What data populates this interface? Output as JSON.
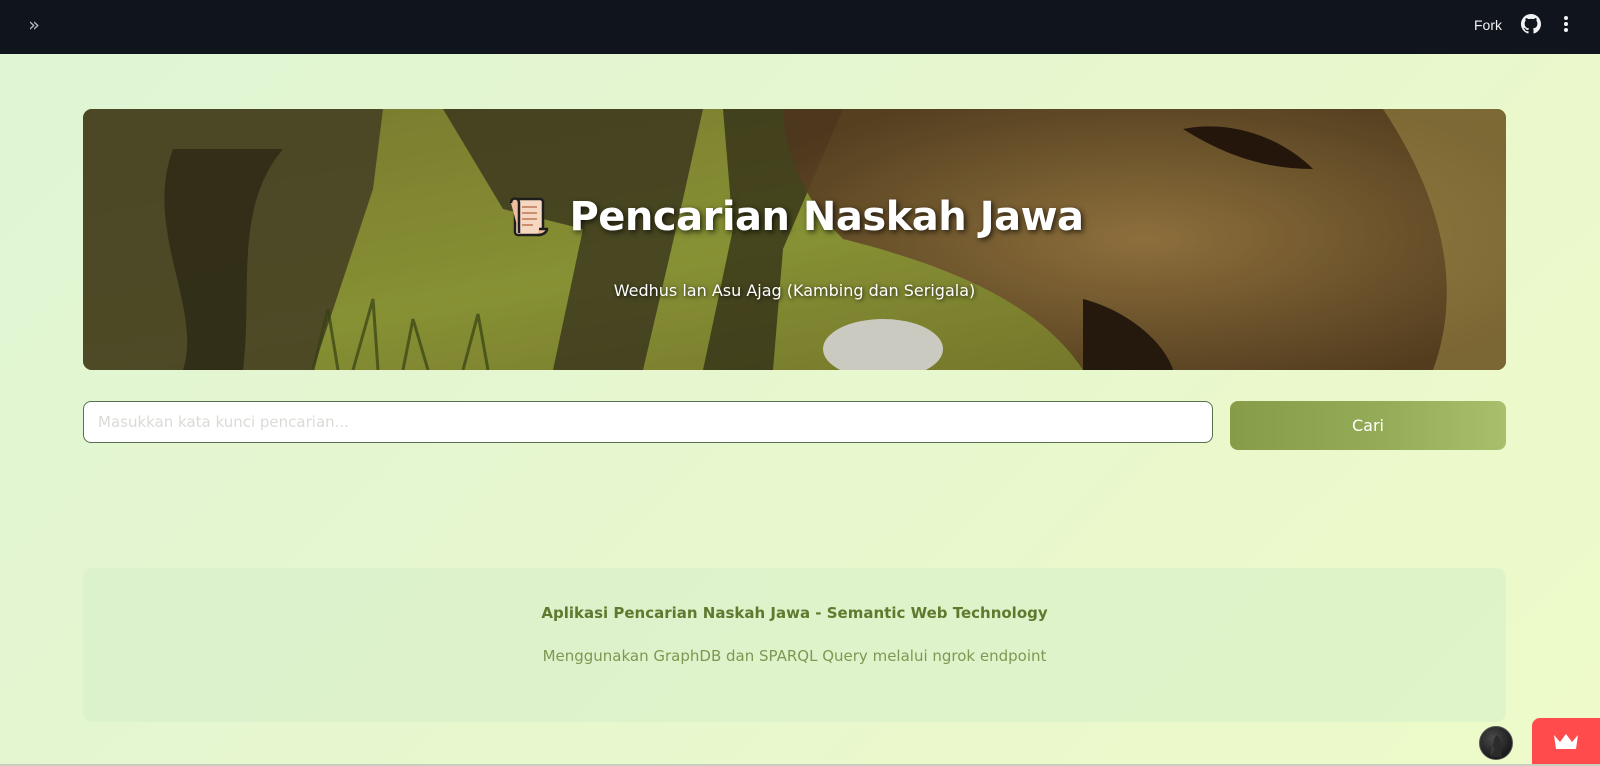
{
  "topbar": {
    "sidebar_toggle_icon": "double-chevron-right-icon",
    "fork_label": "Fork",
    "github_icon": "github-icon",
    "menu_icon": "kebab-menu-icon",
    "background_color": "#0f141d"
  },
  "hero": {
    "icon": "scroll-icon",
    "title": "Pencarian Naskah Jawa",
    "subtitle": "Wedhus lan Asu Ajag (Kambing dan Serigala)"
  },
  "search": {
    "placeholder": "Masukkan kata kunci pencarian...",
    "value": "",
    "button_label": "Cari",
    "button_color": "#8ea351"
  },
  "footer": {
    "title": "Aplikasi Pencarian Naskah Jawa - Semantic Web Technology",
    "text": "Menggunakan GraphDB dan SPARQL Query melalui ngrok endpoint"
  },
  "widgets": {
    "avatar_icon": "user-avatar-icon",
    "crown_icon": "crown-icon",
    "crown_button_color": "#ff4b4b"
  }
}
